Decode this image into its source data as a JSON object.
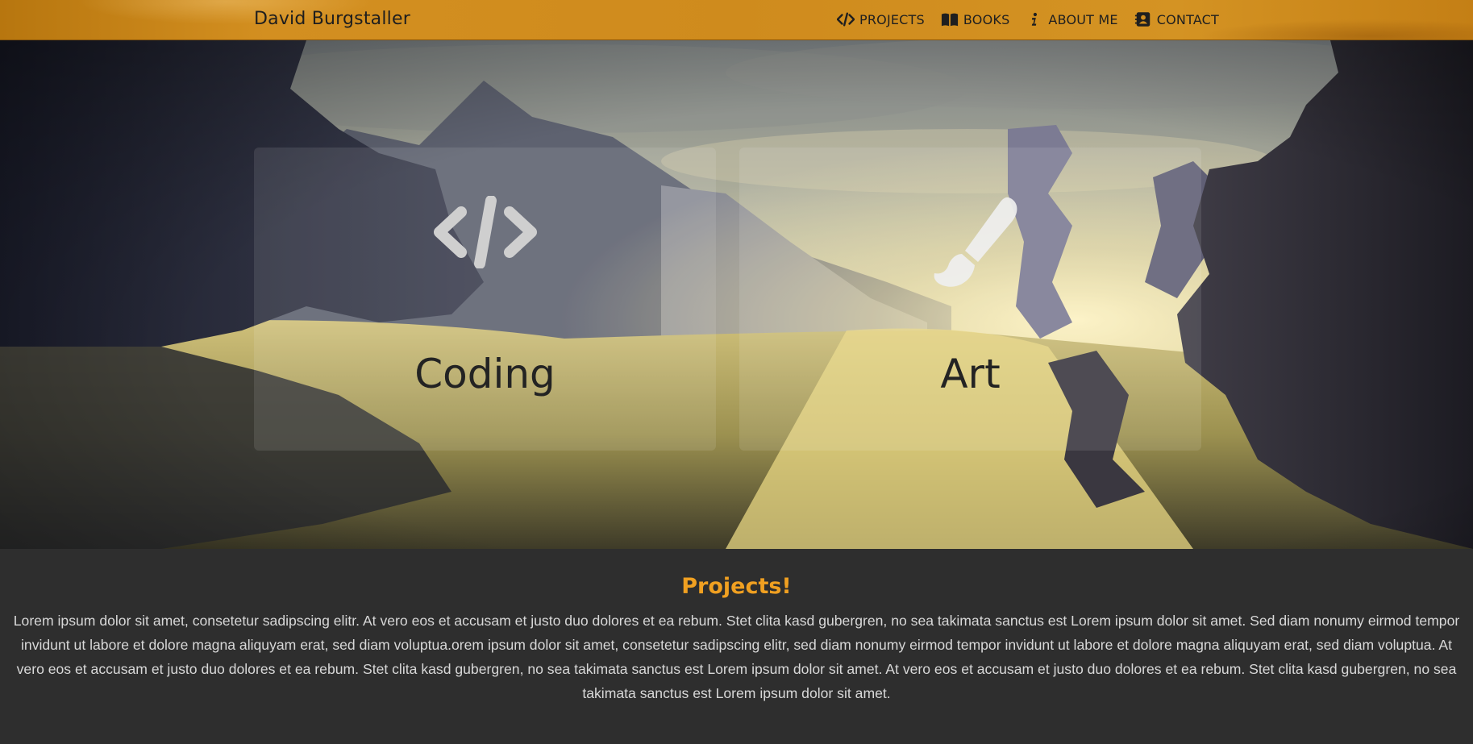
{
  "navbar": {
    "brand": "David Burgstaller",
    "items": [
      {
        "label": "PROJECTS",
        "icon": "code-icon"
      },
      {
        "label": "BOOKS",
        "icon": "book-icon"
      },
      {
        "label": "ABOUT ME",
        "icon": "info-icon"
      },
      {
        "label": "CONTACT",
        "icon": "contact-card-icon"
      }
    ]
  },
  "hero": {
    "cards": [
      {
        "title": "Coding",
        "icon": "code-icon"
      },
      {
        "title": "Art",
        "icon": "paintbrush-icon"
      }
    ]
  },
  "section": {
    "heading": "Projects!",
    "body": "Lorem ipsum dolor sit amet, consetetur sadipscing elitr. At vero eos et accusam et justo duo dolores et ea rebum. Stet clita kasd gubergren, no sea takimata sanctus est Lorem ipsum dolor sit amet. Sed diam nonumy eirmod tempor invidunt ut labore et dolore magna aliquyam erat, sed diam voluptua.orem ipsum dolor sit amet, consetetur sadipscing elitr, sed diam nonumy eirmod tempor invidunt ut labore et dolore magna aliquyam erat, sed diam voluptua. At vero eos et accusam et justo duo dolores et ea rebum. Stet clita kasd gubergren, no sea takimata sanctus est Lorem ipsum dolor sit amet. At vero eos et accusam et justo duo dolores et ea rebum. Stet clita kasd gubergren, no sea takimata sanctus est Lorem ipsum dolor sit amet."
  },
  "colors": {
    "navbar": "#d08d1f",
    "accent": "#f0a021",
    "content_bg": "#2e2e2e",
    "text": "#d8d8d8"
  }
}
